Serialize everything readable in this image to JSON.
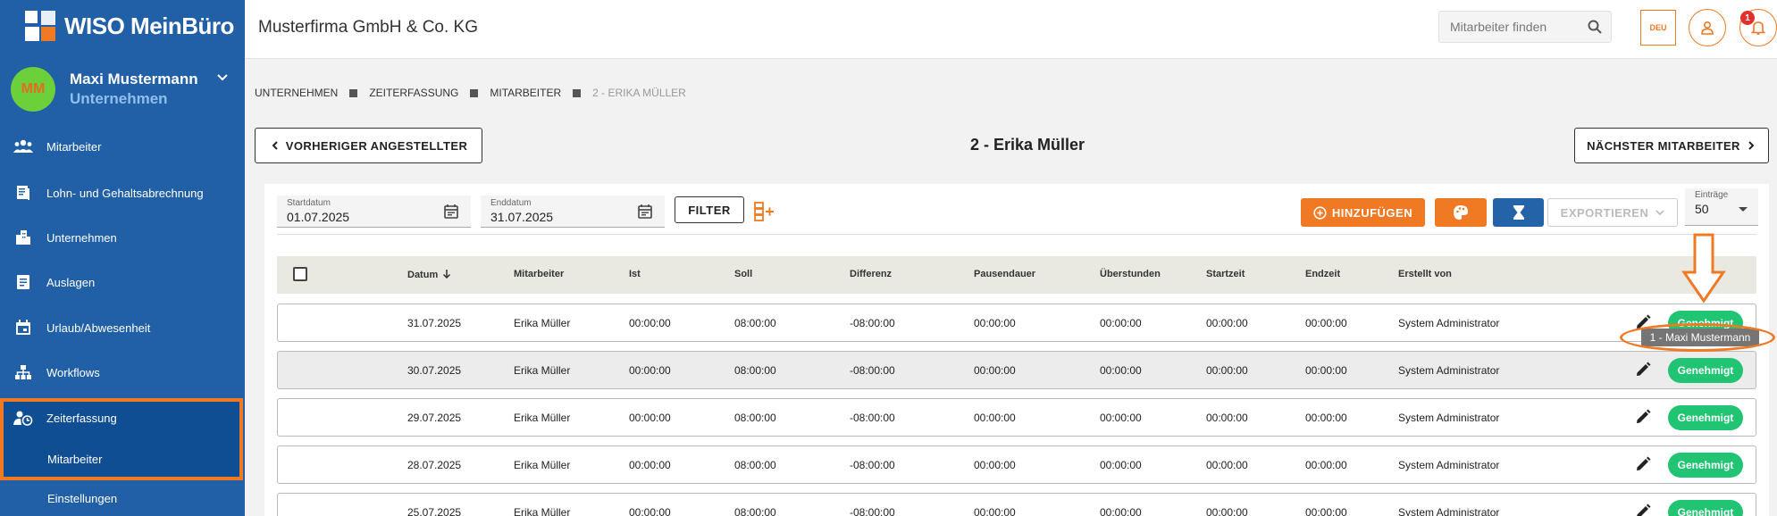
{
  "brand": {
    "logo_text": "WISO MeinBüro",
    "accent": "#f07a24",
    "sidebar_color": "#2160a6"
  },
  "user": {
    "initials": "MM",
    "name": "Maxi Mustermann",
    "role": "Unternehmen"
  },
  "sidebar": {
    "items": [
      {
        "label": "Mitarbeiter",
        "icon": "people-icon"
      },
      {
        "label": "Lohn- und Gehaltsabrechnung",
        "icon": "payroll-icon"
      },
      {
        "label": "Unternehmen",
        "icon": "building-icon"
      },
      {
        "label": "Auslagen",
        "icon": "receipt-icon"
      },
      {
        "label": "Urlaub/Abwesenheit",
        "icon": "calendar-icon"
      },
      {
        "label": "Workflows",
        "icon": "workflow-icon"
      },
      {
        "label": "Zeiterfassung",
        "icon": "time-tracking-icon",
        "active": true
      }
    ],
    "subitems": [
      "Mitarbeiter",
      "Einstellungen"
    ]
  },
  "header": {
    "company": "Musterfirma GmbH & Co. KG",
    "search_placeholder": "Mitarbeiter finden",
    "language": "DEU",
    "notification_count": "1"
  },
  "breadcrumb": [
    "UNTERNEHMEN",
    "ZEITERFASSUNG",
    "MITARBEITER",
    "2 - ERIKA MÜLLER"
  ],
  "employee_nav": {
    "prev_label": "VORHERIGER ANGESTELLTER",
    "title": "2 - Erika Müller",
    "next_label": "NÄCHSTER MITARBEITER"
  },
  "filters": {
    "start_label": "Startdatum",
    "start_value": "01.07.2025",
    "end_label": "Enddatum",
    "end_value": "31.07.2025",
    "filter_button": "FILTER"
  },
  "toolbar": {
    "add_label": "HINZUFÜGEN",
    "export_label": "EXPORTIEREN",
    "entries_label": "Einträge",
    "entries_value": "50"
  },
  "table": {
    "columns": [
      "Datum",
      "Mitarbeiter",
      "Ist",
      "Soll",
      "Differenz",
      "Pausendauer",
      "Überstunden",
      "Startzeit",
      "Endzeit",
      "Erstellt von"
    ],
    "rows": [
      {
        "datum": "31.07.2025",
        "mitarbeiter": "Erika Müller",
        "ist": "00:00:00",
        "soll": "08:00:00",
        "differenz": "-08:00:00",
        "pause": "00:00:00",
        "ueberstunden": "00:00:00",
        "startzeit": "00:00:00",
        "endzeit": "00:00:00",
        "erstellt_von": "System Administrator",
        "status": "Genehmigt"
      },
      {
        "datum": "30.07.2025",
        "mitarbeiter": "Erika Müller",
        "ist": "00:00:00",
        "soll": "08:00:00",
        "differenz": "-08:00:00",
        "pause": "00:00:00",
        "ueberstunden": "00:00:00",
        "startzeit": "00:00:00",
        "endzeit": "00:00:00",
        "erstellt_von": "System Administrator",
        "status": "Genehmigt"
      },
      {
        "datum": "29.07.2025",
        "mitarbeiter": "Erika Müller",
        "ist": "00:00:00",
        "soll": "08:00:00",
        "differenz": "-08:00:00",
        "pause": "00:00:00",
        "ueberstunden": "00:00:00",
        "startzeit": "00:00:00",
        "endzeit": "00:00:00",
        "erstellt_von": "System Administrator",
        "status": "Genehmigt"
      },
      {
        "datum": "28.07.2025",
        "mitarbeiter": "Erika Müller",
        "ist": "00:00:00",
        "soll": "08:00:00",
        "differenz": "-08:00:00",
        "pause": "00:00:00",
        "ueberstunden": "00:00:00",
        "startzeit": "00:00:00",
        "endzeit": "00:00:00",
        "erstellt_von": "System Administrator",
        "status": "Genehmigt"
      },
      {
        "datum": "25.07.2025",
        "mitarbeiter": "Erika Müller",
        "ist": "00:00:00",
        "soll": "08:00:00",
        "differenz": "-08:00:00",
        "pause": "00:00:00",
        "ueberstunden": "00:00:00",
        "startzeit": "00:00:00",
        "endzeit": "00:00:00",
        "erstellt_von": "System Administrator",
        "status": "Genehmigt"
      }
    ]
  },
  "tooltip": {
    "text": "1 - Maxi Mustermann"
  }
}
